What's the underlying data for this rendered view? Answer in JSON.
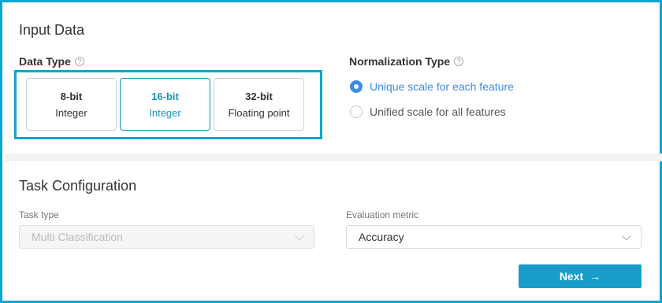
{
  "input_data": {
    "title": "Input Data",
    "data_type_label": "Data Type",
    "data_types": [
      {
        "line1": "8-bit",
        "line2": "Integer",
        "selected": false
      },
      {
        "line1": "16-bit",
        "line2": "Integer",
        "selected": true
      },
      {
        "line1": "32-bit",
        "line2": "Floating point",
        "selected": false
      }
    ],
    "normalization_label": "Normalization Type",
    "normalization_options": [
      {
        "label": "Unique scale for each feature",
        "selected": true
      },
      {
        "label": "Unified scale for all features",
        "selected": false
      }
    ]
  },
  "task_config": {
    "title": "Task Configuration",
    "task_type_label": "Task type",
    "task_type_value": "Multi Classification",
    "task_type_disabled": true,
    "metric_label": "Evaluation metric",
    "metric_value": "Accuracy"
  },
  "actions": {
    "next_label": "Next"
  },
  "colors": {
    "accent": "#0aa6cf",
    "selected_blue": "#3a8ee6",
    "button_bg": "#1a9cc8"
  },
  "icons": {
    "help": "question-circle-icon",
    "next": "arrow-right-icon",
    "dropdown": "chevron-down-icon"
  }
}
